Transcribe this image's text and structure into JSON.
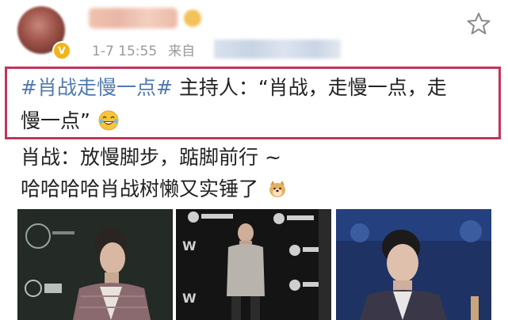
{
  "post": {
    "meta": {
      "time": "1-7 15:55",
      "source_label": "来自"
    },
    "hashtag": "#肖战走慢一点#",
    "line1_rest": " 主持人：“肖战，走慢一点，走",
    "line2": "慢一点”",
    "line3": "肖战：放慢脚步，踮脚前行 ~",
    "line4": "哈哈哈哈肖战树懒又实锤了"
  },
  "colors": {
    "hashtag": "#4f7ab1",
    "highlight_border": "#c2345a",
    "meta_text": "#9a9a9a"
  },
  "icons": {
    "favorite": "star-icon",
    "verified": "verified-badge-icon",
    "laugh_emoji": "laughing-emoji-icon",
    "doge_emoji": "doge-emoji-icon"
  }
}
